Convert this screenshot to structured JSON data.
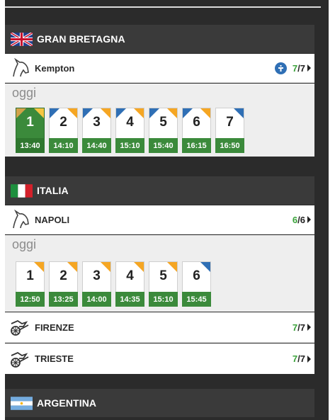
{
  "countries": [
    {
      "name": "GRAN BRETAGNA",
      "flag": "uk"
    },
    {
      "name": "ITALIA",
      "flag": "it"
    },
    {
      "name": "ARGENTINA",
      "flag": "ar"
    }
  ],
  "tracks": {
    "kempton": {
      "name": "Kempton",
      "done": "7",
      "total": "7",
      "icon": "horse-head-icon"
    },
    "napoli": {
      "name": "NAPOLI",
      "done": "6",
      "total": "6",
      "icon": "horse-head-icon"
    },
    "firenze": {
      "name": "FIRENZE",
      "done": "7",
      "total": "7",
      "icon": "trotting-cart-icon"
    },
    "trieste": {
      "name": "TRIESTE",
      "done": "7",
      "total": "7",
      "icon": "trotting-cart-icon"
    }
  },
  "day_label": "oggi",
  "count_separator": "/",
  "kempton_races": [
    {
      "num": "1",
      "time": "13:40",
      "active": true
    },
    {
      "num": "2",
      "time": "14:10"
    },
    {
      "num": "3",
      "time": "14:40"
    },
    {
      "num": "4",
      "time": "15:10"
    },
    {
      "num": "5",
      "time": "15:40"
    },
    {
      "num": "6",
      "time": "16:15"
    },
    {
      "num": "7",
      "time": "16:50"
    }
  ],
  "napoli_races": [
    {
      "num": "1",
      "time": "12:50"
    },
    {
      "num": "2",
      "time": "13:25"
    },
    {
      "num": "3",
      "time": "14:00"
    },
    {
      "num": "4",
      "time": "14:35"
    },
    {
      "num": "5",
      "time": "15:10"
    },
    {
      "num": "6",
      "time": "15:45"
    }
  ],
  "colors": {
    "accent_green": "#3b8a3b",
    "count_green": "#3aa23a",
    "corner_orange": "#f5a623",
    "corner_blue": "#2f6fb5",
    "header_bg": "#3a3a3a"
  }
}
